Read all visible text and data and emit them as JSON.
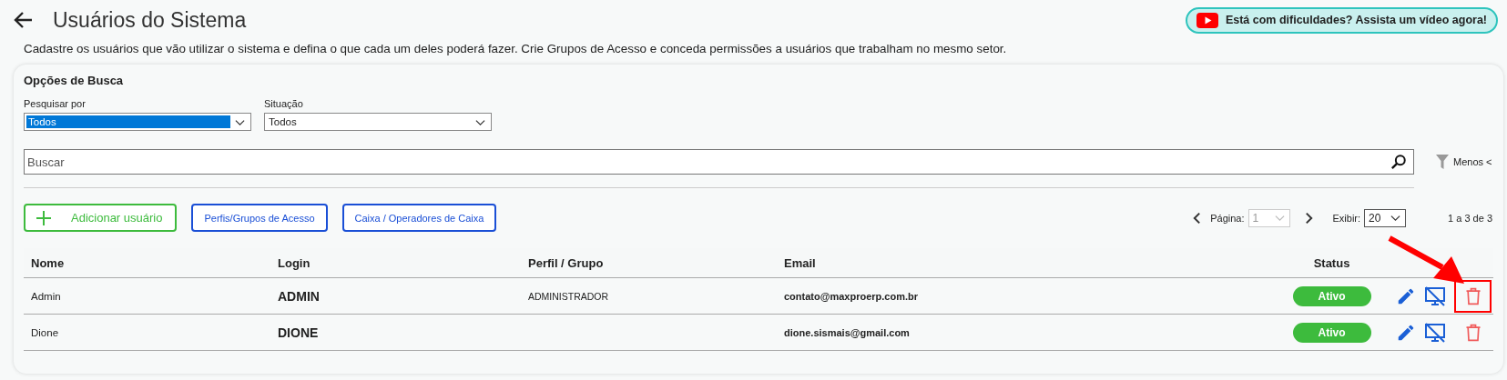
{
  "header": {
    "title": "Usuários do Sistema",
    "help_link": "Está com dificuldades? Assista um vídeo agora!",
    "description": "Cadastre os usuários que vão utilizar o sistema e defina o que cada um deles poderá fazer. Crie Grupos de Acesso e conceda permissões a usuários que trabalham no mesmo setor."
  },
  "search_options": {
    "title": "Opções de Busca",
    "filters": [
      {
        "label": "Pesquisar por",
        "value": "Todos",
        "focused": true
      },
      {
        "label": "Situação",
        "value": "Todos",
        "focused": false
      }
    ],
    "search": {
      "placeholder": "Buscar"
    },
    "toggle": "Menos <"
  },
  "actions": [
    {
      "label": "Adicionar usuário",
      "kind": "add"
    },
    {
      "label": "Perfis/Grupos de Acesso",
      "kind": "link"
    },
    {
      "label": "Caixa / Operadores de Caixa",
      "kind": "link"
    }
  ],
  "pagination": {
    "page_label": "Página:",
    "page": "1",
    "page_disabled": true,
    "show_label": "Exibir:",
    "show": "20",
    "range": "1 a 3 de 3"
  },
  "table": {
    "columns": [
      "Nome",
      "Login",
      "Perfil / Grupo",
      "Email",
      "Status"
    ],
    "rows": [
      {
        "name": "Admin",
        "login": "ADMIN",
        "group": "ADMINISTRADOR",
        "email": "contato@maxproerp.com.br",
        "status": "Ativo",
        "highlighted": true
      },
      {
        "name": "Dione",
        "login": "DIONE",
        "email": "dione.sismais@gmail.com",
        "status": "Ativo",
        "highlighted": false
      }
    ]
  }
}
